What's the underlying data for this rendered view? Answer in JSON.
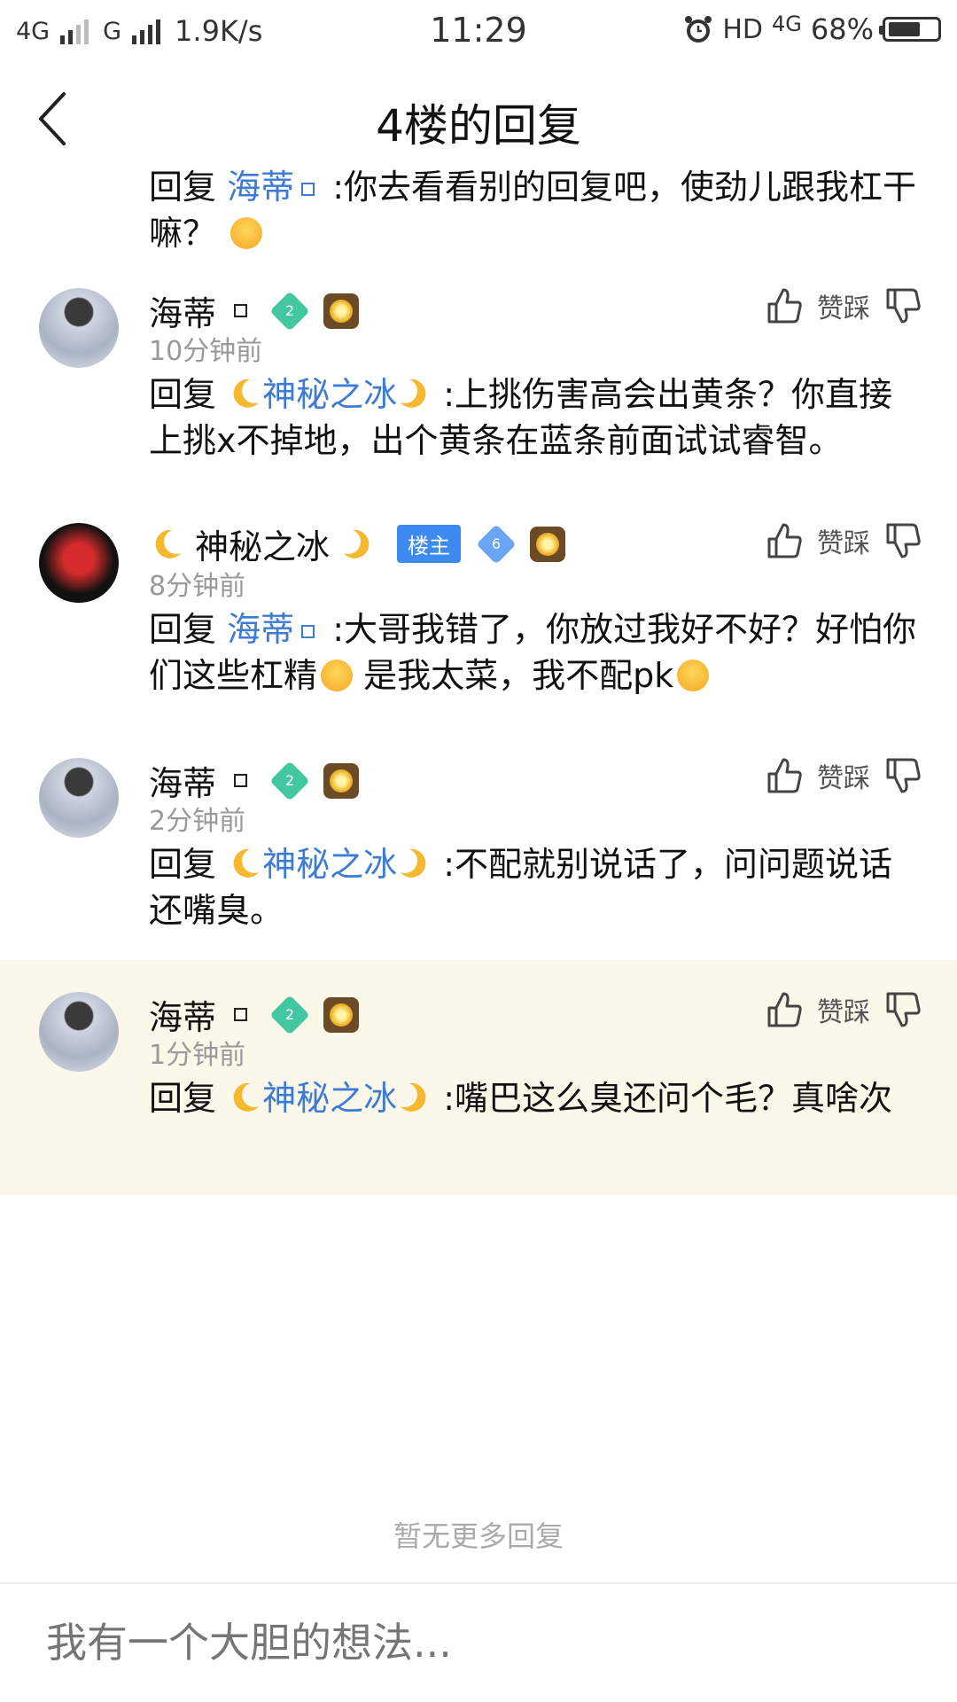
{
  "status_bar": {
    "net1": "4G",
    "net2": "G",
    "speed": "1.9K/s",
    "time": "11:29",
    "hd": "HD",
    "net_small": "4G",
    "battery": "68%",
    "battery_level": 0.68
  },
  "header": {
    "title": "4楼的回复"
  },
  "partial": {
    "prefix": "回复",
    "mention": "海蒂",
    "text": ":你去看看别的回复吧，使劲儿跟我杠干嘛？"
  },
  "comments": [
    {
      "user": "海蒂",
      "level": "2",
      "time": "10分钟前",
      "prefix": "回复",
      "mention": "神秘之冰",
      "text": ":上挑伤害高会出黄条？你直接上挑x不掉地，出个黄条在蓝条前面试试睿智。"
    },
    {
      "user": "神秘之冰",
      "owner_badge": "楼主",
      "level": "6",
      "time": "8分钟前",
      "prefix": "回复",
      "mention": "海蒂",
      "text1": ":大哥我错了，你放过我好不好？好怕你们这些杠精",
      "text2": "是我太菜，我不配pk"
    },
    {
      "user": "海蒂",
      "level": "2",
      "time": "2分钟前",
      "prefix": "回复",
      "mention": "神秘之冰",
      "text": ":不配就别说话了，问问题说话还嘴臭。"
    },
    {
      "user": "海蒂",
      "level": "2",
      "time": "1分钟前",
      "prefix": "回复",
      "mention": "神秘之冰",
      "text": ":嘴巴这么臭还问个毛？真啥次"
    }
  ],
  "actions": {
    "label": "赞踩"
  },
  "footer": {
    "no_more": "暂无更多回复",
    "input_placeholder": "我有一个大胆的想法..."
  },
  "colors": {
    "mention": "#3d7bd5",
    "highlight_bg": "#fbf8ea",
    "owner_badge": "#3d8af0"
  }
}
